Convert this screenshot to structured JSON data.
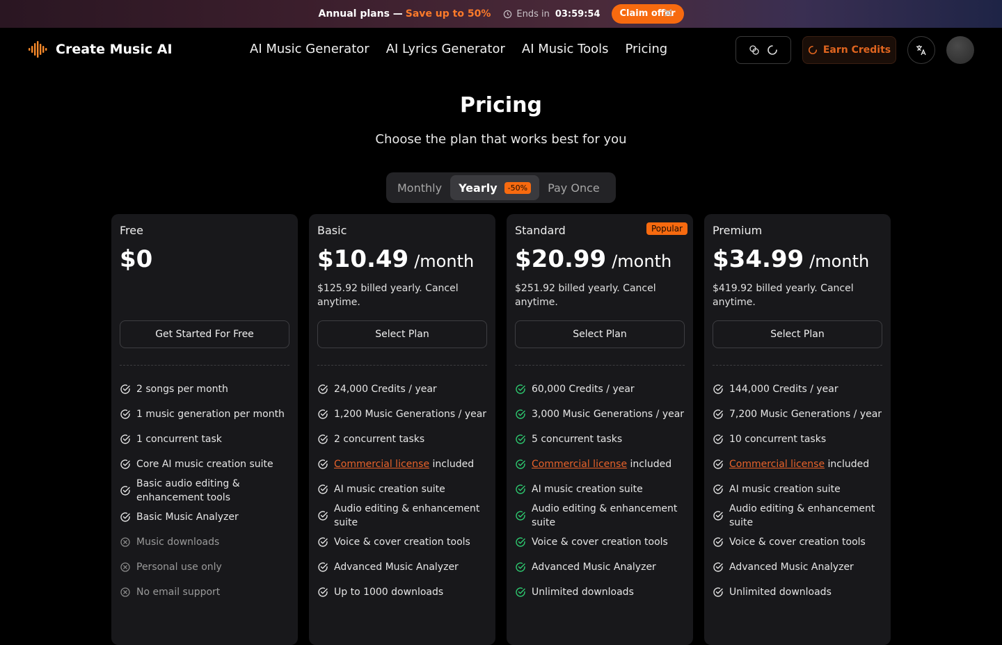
{
  "promo": {
    "title": "Annual plans —",
    "save": "Save up to 50%",
    "ends_label": "Ends in",
    "timer": "03:59:54",
    "claim": "Claim offer"
  },
  "nav": {
    "brand": "Create Music AI",
    "menu": [
      "AI Music Generator",
      "AI Lyrics Generator",
      "AI Music Tools",
      "Pricing"
    ],
    "earn": "Earn Credits"
  },
  "page": {
    "title": "Pricing",
    "subtitle": "Choose the plan that works best for you"
  },
  "toggle": {
    "monthly": "Monthly",
    "yearly": "Yearly",
    "badge": "-50%",
    "once": "Pay Once"
  },
  "colors": {
    "accent": "#f76a0f",
    "check_green": "#2ecc71",
    "card_bg": "#18181b"
  },
  "plans": [
    {
      "name": "Free",
      "price": "$0",
      "per": "",
      "billing": "",
      "button": "Get Started For Free",
      "features": [
        {
          "text": "2 songs per month",
          "state": "check"
        },
        {
          "text": "1 music generation per month",
          "state": "check"
        },
        {
          "text": "1 concurrent task",
          "state": "check"
        },
        {
          "text": "Core AI music creation suite",
          "state": "check"
        },
        {
          "text": "Basic audio editing & enhancement tools",
          "state": "check"
        },
        {
          "text": "Basic Music Analyzer",
          "state": "check"
        },
        {
          "text": "Music downloads",
          "state": "cross"
        },
        {
          "text": "Personal use only",
          "state": "cross"
        },
        {
          "text": "No email support",
          "state": "cross"
        }
      ]
    },
    {
      "name": "Basic",
      "price": "$10.49",
      "per": "/month",
      "billing": "$125.92 billed yearly. Cancel anytime.",
      "button": "Select Plan",
      "features": [
        {
          "text": "24,000 Credits / year",
          "state": "check"
        },
        {
          "text": "1,200 Music Generations / year",
          "state": "check"
        },
        {
          "text": "2 concurrent tasks",
          "state": "check"
        },
        {
          "link": "Commercial license",
          "text": " included",
          "state": "check"
        },
        {
          "text": "AI music creation suite",
          "state": "check"
        },
        {
          "text": "Audio editing & enhancement suite",
          "state": "check"
        },
        {
          "text": "Voice & cover creation tools",
          "state": "check"
        },
        {
          "text": "Advanced Music Analyzer",
          "state": "check"
        },
        {
          "text": "Up to 1000 downloads",
          "state": "check"
        }
      ]
    },
    {
      "name": "Standard",
      "price": "$20.99",
      "per": "/month",
      "badge": "Popular",
      "billing": "$251.92 billed yearly. Cancel anytime.",
      "button": "Select Plan",
      "features": [
        {
          "text": "60,000 Credits / year",
          "state": "green"
        },
        {
          "text": "3,000 Music Generations / year",
          "state": "green"
        },
        {
          "text": "5 concurrent tasks",
          "state": "green"
        },
        {
          "link": "Commercial license",
          "text": " included",
          "state": "green"
        },
        {
          "text": "AI music creation suite",
          "state": "green"
        },
        {
          "text": "Audio editing & enhancement suite",
          "state": "green"
        },
        {
          "text": "Voice & cover creation tools",
          "state": "green"
        },
        {
          "text": "Advanced Music Analyzer",
          "state": "green"
        },
        {
          "text": "Unlimited downloads",
          "state": "green"
        }
      ]
    },
    {
      "name": "Premium",
      "price": "$34.99",
      "per": "/month",
      "billing": "$419.92 billed yearly. Cancel anytime.",
      "button": "Select Plan",
      "features": [
        {
          "text": "144,000 Credits / year",
          "state": "check"
        },
        {
          "text": "7,200 Music Generations / year",
          "state": "check"
        },
        {
          "text": "10 concurrent tasks",
          "state": "check"
        },
        {
          "link": "Commercial license",
          "text": " included",
          "state": "check"
        },
        {
          "text": "AI music creation suite",
          "state": "check"
        },
        {
          "text": "Audio editing & enhancement suite",
          "state": "check"
        },
        {
          "text": "Voice & cover creation tools",
          "state": "check"
        },
        {
          "text": "Advanced Music Analyzer",
          "state": "check"
        },
        {
          "text": "Unlimited downloads",
          "state": "check"
        }
      ]
    }
  ]
}
